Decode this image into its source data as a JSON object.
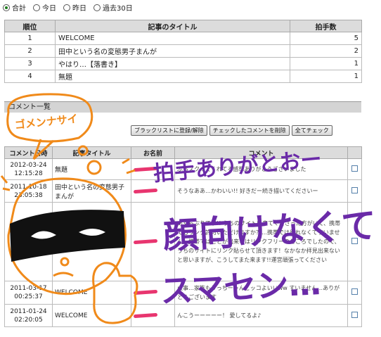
{
  "periods": [
    {
      "label": "合計",
      "checked": true
    },
    {
      "label": "今日",
      "checked": false
    },
    {
      "label": "昨日",
      "checked": false
    },
    {
      "label": "過去30日",
      "checked": false
    }
  ],
  "ranking": {
    "headers": {
      "rank": "順位",
      "title": "記事のタイトル",
      "count": "拍手数"
    },
    "rows": [
      {
        "rank": "1",
        "title": "WELCOME",
        "count": "5"
      },
      {
        "rank": "2",
        "title": "田中という名の変態男子まんが",
        "count": "2"
      },
      {
        "rank": "3",
        "title": "やはり…【落書き】",
        "count": "1"
      },
      {
        "rank": "4",
        "title": "無題",
        "count": "1"
      }
    ]
  },
  "comments_section": {
    "title": "コメント一覧",
    "buttons": {
      "blacklist": "ブラックリストに登録/解除",
      "delete": "チェックしたコメントを削除",
      "check_all": "全てチェック"
    },
    "headers": {
      "date": "コメント日時",
      "title": "記事タイトル",
      "name": "お名前",
      "comment": "コメント"
    },
    "rows": [
      {
        "date": "2012-03-24 12:15:28",
        "title": "無題",
        "comment": "ぷらズク…てくれてる感想ありがとうございました"
      },
      {
        "date": "2011-10-18 23:05:38",
        "title": "田中という名の変態男子まんが",
        "comment": "そうなああ…かわいい!! 好きだー続き描いてくださいー"
      },
      {
        "date": "",
        "title": "",
        "comment": "あくらぶりです!! うちのサイトに来てくださった方がいて、携帯でもリンク許可いただけますか？…携帯では見れなくてすいません…携帯ではことが出来るはリンクフリーのところでしたので、うちのサイトにリンク貼らせて頂きます！なかなか拝見出来ないと思いますが、こうしてまた来ます!!運営頑張ってください"
      },
      {
        "date": "2011-03-17 00:25:37",
        "title": "WELCOME",
        "comment": "火事…家族もうっちーゃんこッコよいいww すいません…ありがとうございます"
      },
      {
        "date": "2011-01-24 02:20:05",
        "title": "WELCOME",
        "comment": "んこうーーーーー！ 愛してるよ♪"
      }
    ]
  },
  "doodle_text": {
    "gomen": "ゴメンナサイ",
    "thanks": "拍手ありがとおー",
    "no_face": "顔向けなくて",
    "sorry": "スマセン…"
  },
  "colors": {
    "doodle_orange": "#f08a1a",
    "doodle_purple": "#6a2aa8",
    "scribble_pink": "#e8356f",
    "header_bg": "#dcdcdc"
  }
}
